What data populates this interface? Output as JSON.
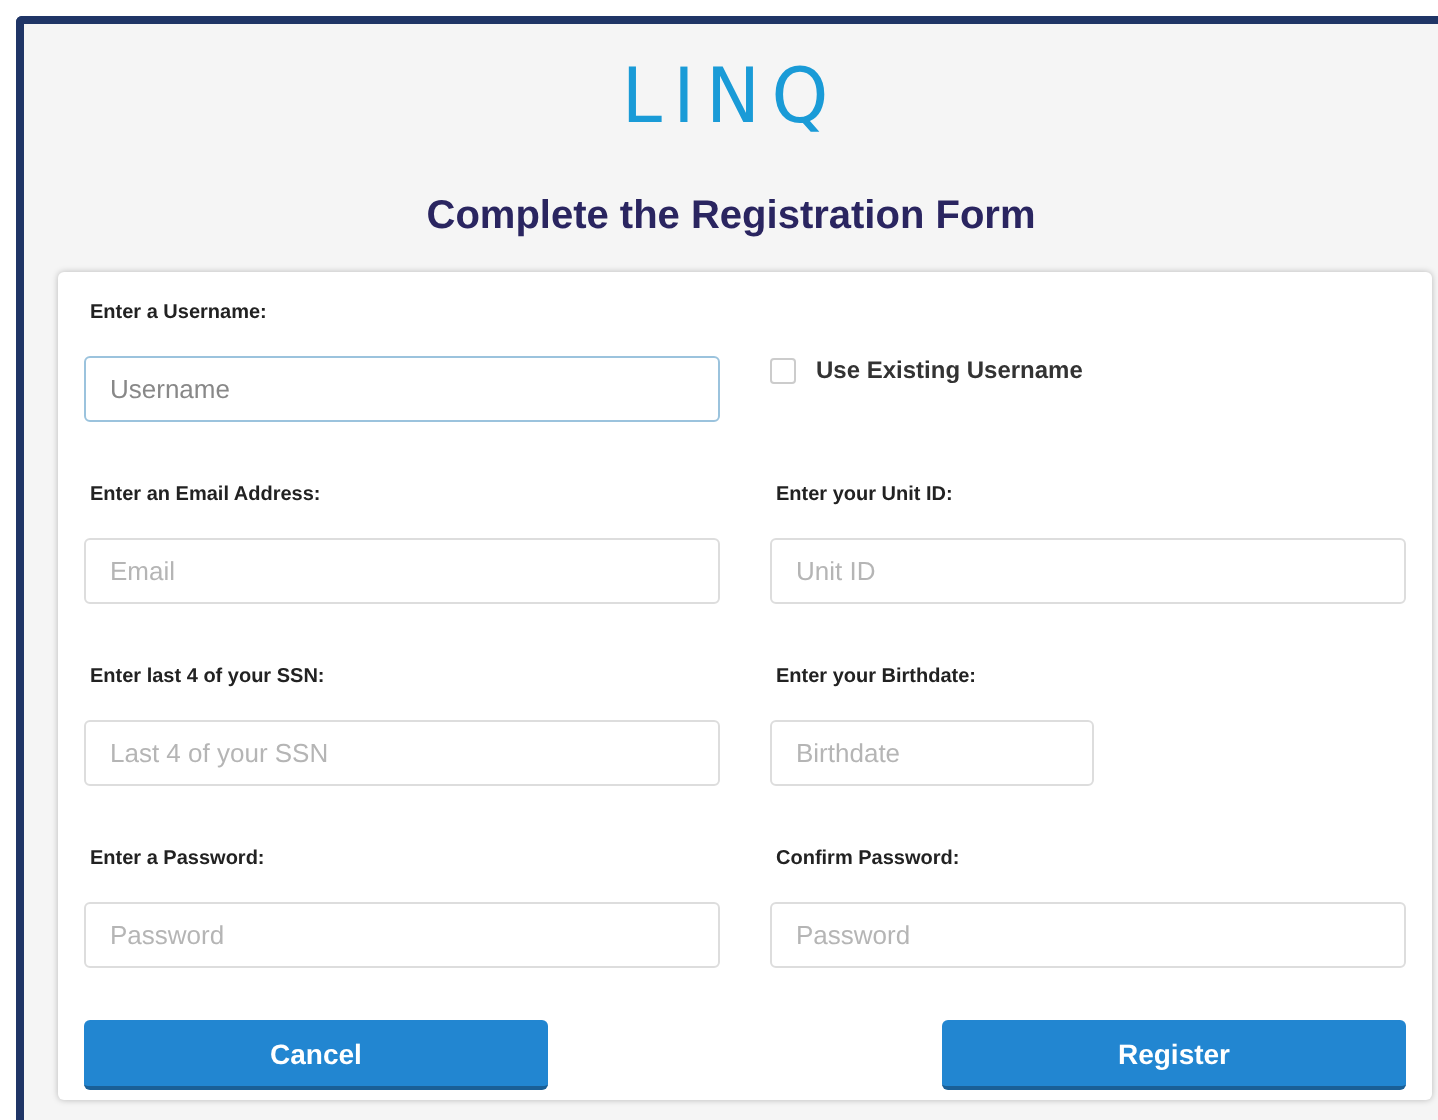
{
  "logo": "LINQ",
  "title": "Complete the Registration Form",
  "form_rows": [
    {
      "cells": [
        {
          "kind": "input",
          "label": "Enter a Username:",
          "placeholder": "Username",
          "focused": true
        },
        {
          "kind": "checkbox",
          "label": "Use Existing Username",
          "checked": false
        }
      ]
    },
    {
      "cells": [
        {
          "kind": "input",
          "label": "Enter an Email Address:",
          "placeholder": "Email",
          "focused": false
        },
        {
          "kind": "input",
          "label": "Enter your Unit ID:",
          "placeholder": "Unit ID",
          "focused": false
        }
      ]
    },
    {
      "cells": [
        {
          "kind": "input",
          "label": "Enter last 4 of your SSN:",
          "placeholder": "Last 4 of your SSN",
          "focused": false
        },
        {
          "kind": "date",
          "label": "Enter your Birthdate:",
          "placeholder": "Birthdate",
          "focused": false
        }
      ]
    },
    {
      "cells": [
        {
          "kind": "input",
          "label": "Enter a Password:",
          "placeholder": "Password",
          "focused": false
        },
        {
          "kind": "input",
          "label": "Confirm Password:",
          "placeholder": "Password",
          "focused": false
        }
      ]
    }
  ],
  "buttons": [
    "Cancel",
    "Register"
  ]
}
